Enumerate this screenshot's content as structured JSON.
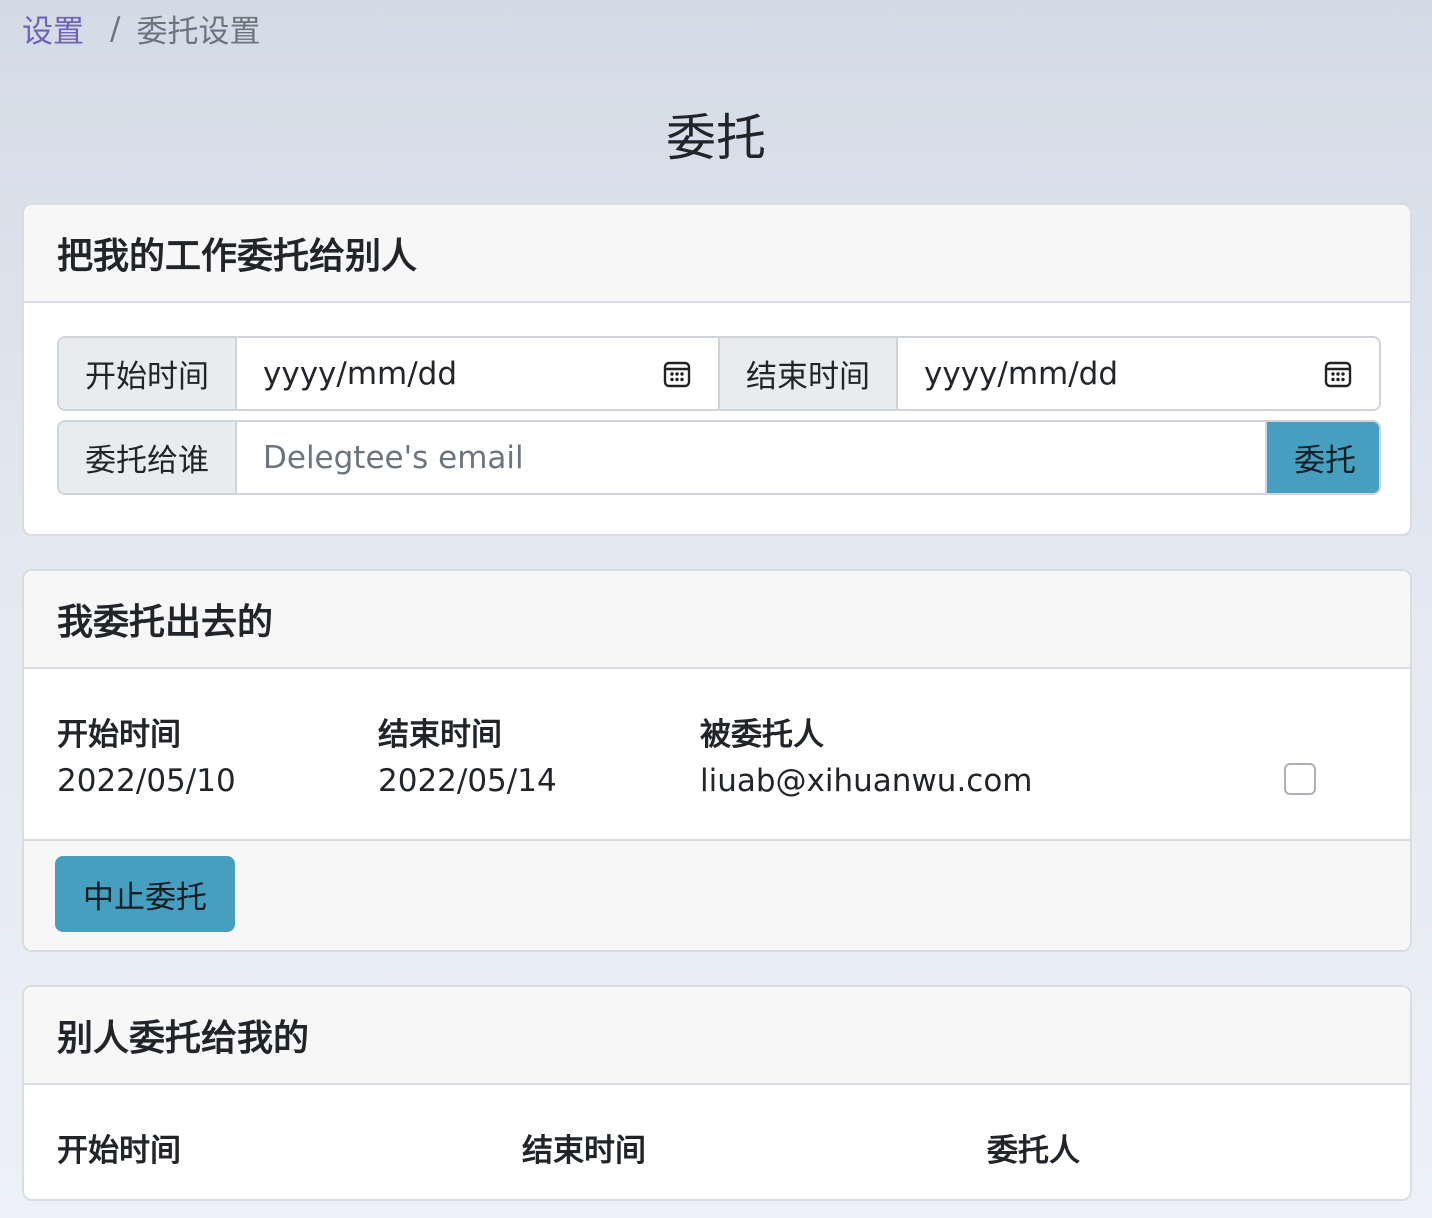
{
  "breadcrumb": {
    "parent": "设置",
    "separator": "/",
    "current": "委托设置"
  },
  "page_title": "委托",
  "delegate_card": {
    "title": "把我的工作委托给别人",
    "start_label": "开始时间",
    "start_value": "yyyy/mm/dd",
    "end_label": "结束时间",
    "end_value": "yyyy/mm/dd",
    "to_label": "委托给谁",
    "email_placeholder": "Delegtee's email",
    "submit_label": "委托"
  },
  "outgoing_card": {
    "title": "我委托出去的",
    "columns": [
      "开始时间",
      "结束时间",
      "被委托人"
    ],
    "rows": [
      {
        "start": "2022/05/10",
        "end": "2022/05/14",
        "delegatee": "liuab@xihuanwu.com",
        "checked": false
      }
    ],
    "stop_label": "中止委托"
  },
  "incoming_card": {
    "title": "别人委托给我的",
    "columns": [
      "开始时间",
      "结束时间",
      "委托人"
    ]
  },
  "colors": {
    "accent": "#479fbf",
    "link": "#6f62b8"
  }
}
